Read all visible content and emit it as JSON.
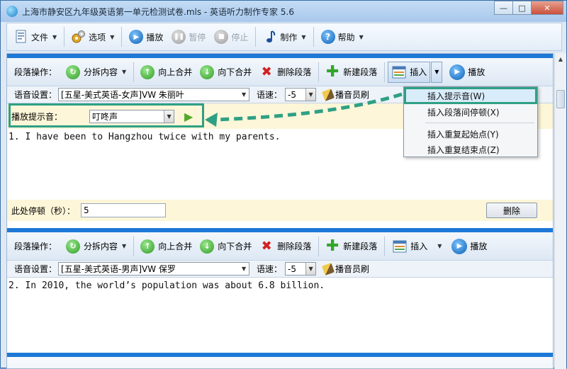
{
  "window": {
    "title": "上海市静安区九年级英语第一单元检测试卷.mls - 英语听力制作专家 5.6",
    "minimize": "—",
    "maximize": "□",
    "close": "✕"
  },
  "main_toolbar": {
    "file": "文件",
    "options": "选项",
    "play": "播放",
    "pause": "暂停",
    "stop": "停止",
    "make": "制作",
    "help": "帮助"
  },
  "para1": {
    "ops_label": "段落操作：",
    "split": "分拆内容",
    "merge_up": "向上合并",
    "merge_down": "向下合并",
    "delete_para": "删除段落",
    "new_para": "新建段落",
    "insert": "插入",
    "play": "播放",
    "voice_label": "语音设置：",
    "voice_value": "[五星-美式英语-女声]VW 朱丽叶",
    "speed_label": "语速：",
    "speed_value": "-5",
    "announcer": "播音员刷",
    "cue_label": "播放提示音：",
    "cue_value": "叮咚声",
    "text": "1. I have been to Hangzhou twice with my parents.",
    "pause_label": "此处停顿（秒）：",
    "pause_value": "5",
    "delete_btn": "删除"
  },
  "para2": {
    "ops_label": "段落操作：",
    "split": "分拆内容",
    "merge_up": "向上合并",
    "merge_down": "向下合并",
    "delete_para": "删除段落",
    "new_para": "新建段落",
    "insert": "插入",
    "play": "播放",
    "voice_label": "语音设置：",
    "voice_value": "[五星-美式英语-男声]VW 保罗",
    "speed_label": "语速：",
    "speed_value": "-5",
    "announcer": "播音员刷",
    "text": "2. In 2010, the world’s population was about 6.8 billion."
  },
  "insert_menu": {
    "items": [
      "插入提示音(W)",
      "插入段落间停顿(X)",
      "插入重复起始点(Y)",
      "插入重复结束点(Z)"
    ]
  },
  "colors": {
    "highlight": "#2fa084",
    "para_bar": "#1d78d6",
    "cue_bg": "#fdf6d8"
  }
}
